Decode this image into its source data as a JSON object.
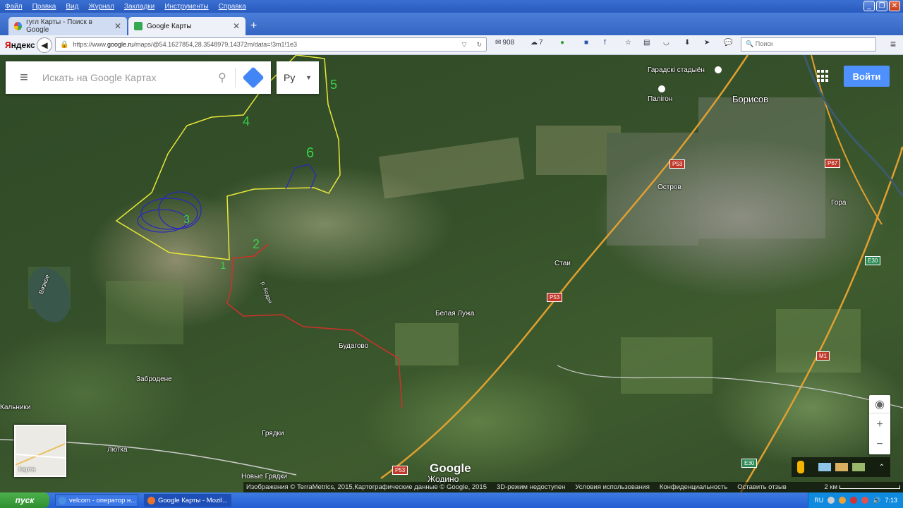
{
  "menubar": {
    "items": [
      "Файл",
      "Правка",
      "Вид",
      "Журнал",
      "Закладки",
      "Инструменты",
      "Справка"
    ]
  },
  "tabs": [
    {
      "label": "гугл Карты - Поиск в Google"
    },
    {
      "label": "Google Карты"
    }
  ],
  "navbar": {
    "yandex_prefix": "Я",
    "yandex_rest": "ндекс",
    "url_prefix": "https://www.",
    "url_domain": "google.ru",
    "url_path": "/maps/@54.1627854,28.3548979,14372m/data=!3m1!1e3",
    "mail_count": "908",
    "weather": "7",
    "search_placeholder": "Поиск"
  },
  "maps_ui": {
    "search_placeholder": "Искать на Google Картах",
    "lang": "Ру",
    "login": "Войти",
    "minimap_label": "Карта",
    "logo": "Google"
  },
  "places": {
    "garad_stadium": "Гарадскі стадыён",
    "palygon": "Палігон",
    "borisov": "Борисов",
    "ostrov": "Остров",
    "gora": "Гора",
    "stai": "Стаи",
    "belaya_luzha": "Белая Лужа",
    "budagovo": "Будагово",
    "zabrodene": "Забродене",
    "kalniki": "Кальники",
    "lyutka": "Лютка",
    "gryadki": "Грядки",
    "novye_gryadki": "Новые Грядки",
    "zhodino": "Жодино",
    "vyazkoe": "Вязкое",
    "r_bodrya": "р. Бодря"
  },
  "shields": {
    "r53_a": "P53",
    "r53_b": "P53",
    "r53_c": "P53",
    "r67": "P67",
    "e30_a": "E30",
    "e30_b": "E30",
    "m1": "M1"
  },
  "annotations": {
    "n1": "1",
    "n2": "2",
    "n3": "3",
    "n4": "4",
    "n5": "5",
    "n6": "6"
  },
  "footer": {
    "imagery": "Изображения © TerraMetrics, 2015,",
    "mapdata": "Картографические данные © Google, 2015",
    "mode3d": "3D-режим недоступен",
    "terms": "Условия использования",
    "privacy": "Конфиденциальность",
    "feedback": "Оставить отзыв",
    "scale": "2 км"
  },
  "taskbar": {
    "start": "пуск",
    "tasks": [
      {
        "label": "velcom - оператор н..."
      },
      {
        "label": "Google Карты - Mozil..."
      }
    ],
    "lang": "RU",
    "time": "7:13"
  }
}
